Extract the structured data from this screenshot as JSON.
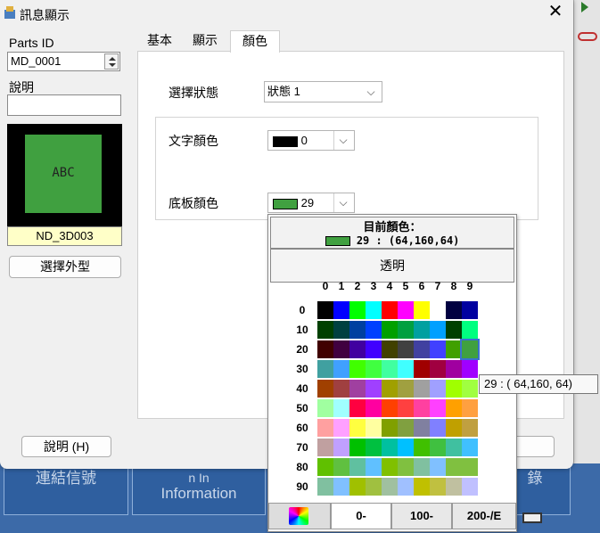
{
  "background": {
    "cell1": "連結信號",
    "cell2": "Information",
    "cell2_top": "n In",
    "cell3": "錄"
  },
  "window": {
    "title": "訊息顯示",
    "close_label": "✕"
  },
  "left": {
    "parts_id_label": "Parts ID",
    "parts_id_value": "MD_0001",
    "desc_label": "說明",
    "desc_value": "",
    "preview_text": "ABC",
    "preview_name": "ND_3D003",
    "choose_button": "選擇外型",
    "help_button": "說明 (H)"
  },
  "tabs": [
    {
      "label": "基本"
    },
    {
      "label": "顯示"
    },
    {
      "label": "顏色"
    }
  ],
  "color_tab": {
    "state_label": "選擇狀態",
    "state_value": "狀態 1",
    "text_color_label": "文字顏色",
    "text_color_value": "0",
    "bg_color_label": "底板顏色",
    "bg_color_value": "29"
  },
  "popup": {
    "current_label": "目前顏色：",
    "current_value": "29 : (64,160,64)",
    "transparent_button": "透明",
    "columns": [
      "0",
      "1",
      "2",
      "3",
      "4",
      "5",
      "6",
      "7",
      "8",
      "9"
    ],
    "rows": [
      "0",
      "10",
      "20",
      "30",
      "40",
      "50",
      "60",
      "70",
      "80",
      "90"
    ],
    "tooltip": "29 : ( 64,160, 64)",
    "page_tabs": [
      "0-",
      "100-",
      "200-/E"
    ],
    "selected_index": 29
  },
  "colors": {
    "accent_green": "#40a040",
    "palette": [
      "#000000",
      "#0000ff",
      "#00ff00",
      "#00ffff",
      "#ff0000",
      "#ff00ff",
      "#ffff00",
      "#ffffff",
      "#000040",
      "#0000a0",
      "#004000",
      "#004040",
      "#0040a0",
      "#0040ff",
      "#00a000",
      "#00a040",
      "#00a0a0",
      "#00a0ff",
      "#004000",
      "#00ff80",
      "#400000",
      "#400040",
      "#4000a0",
      "#4000ff",
      "#404000",
      "#404040",
      "#4040a0",
      "#4040ff",
      "#40a000",
      "#40a040",
      "#40a0a0",
      "#40a0ff",
      "#40ff00",
      "#40ff40",
      "#40ffa0",
      "#40ffff",
      "#a00000",
      "#a00040",
      "#a000a0",
      "#a000ff",
      "#a04000",
      "#a04040",
      "#a040a0",
      "#a040ff",
      "#a0a000",
      "#a0a040",
      "#a0a0a0",
      "#a0a0ff",
      "#a0ff00",
      "#a0ff40",
      "#a0ffa0",
      "#a0ffff",
      "#ff0040",
      "#ff00a0",
      "#ff4000",
      "#ff4040",
      "#ff40a0",
      "#ff40ff",
      "#ffa000",
      "#ffa040",
      "#ffa0a0",
      "#ffa0ff",
      "#ffff40",
      "#ffffa0",
      "#80a000",
      "#80a040",
      "#8080a0",
      "#8080ff",
      "#c0a000",
      "#c0a040",
      "#c0a0a0",
      "#c0a0ff",
      "#00c000",
      "#00c040",
      "#00c0a0",
      "#00c0ff",
      "#40c000",
      "#40c040",
      "#40c0a0",
      "#40c0ff",
      "#60c000",
      "#60c040",
      "#60c0a0",
      "#60c0ff",
      "#80c000",
      "#80c040",
      "#80c0a0",
      "#80c0ff",
      "#80c040",
      "#80c040",
      "#80c0a0",
      "#80c0ff",
      "#a0c000",
      "#a0c040",
      "#a0c0a0",
      "#a0c0ff",
      "#c0c000",
      "#c0c040",
      "#c0c0a0",
      "#c0c0ff"
    ]
  }
}
